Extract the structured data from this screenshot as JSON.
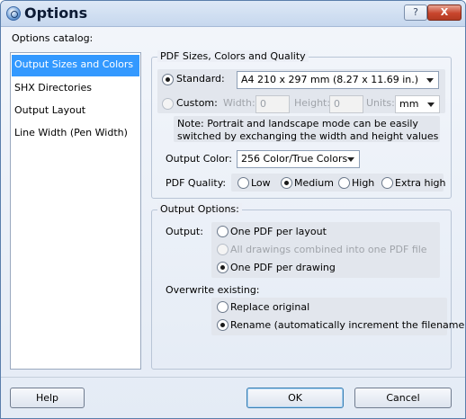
{
  "window": {
    "title": "Options",
    "help_btn": "?",
    "close_btn": "X"
  },
  "catalog": {
    "label": "Options catalog:",
    "items": [
      "Output Sizes and Colors",
      "SHX Directories",
      "Output Layout",
      "Line Width (Pen Width)"
    ]
  },
  "pdf": {
    "group_title": "PDF Sizes, Colors and Quality",
    "standard_label": "Standard:",
    "standard_value": "A4 210 x 297 mm (8.27 x 11.69 in.)",
    "custom_label": "Custom:",
    "width_label": "Width:",
    "width_value": "0",
    "height_label": "Height:",
    "height_value": "0",
    "units_label": "Units:",
    "units_value": "mm",
    "note": "Note: Portrait and landscape mode can be easily switched by exchanging the width and height values",
    "color_label": "Output Color:",
    "color_value": "256 Color/True Colors",
    "quality_label": "PDF Quality:",
    "quality_options": [
      "Low",
      "Medium",
      "High",
      "Extra high"
    ],
    "quality_selected": "Medium"
  },
  "output": {
    "group_title": "Output Options:",
    "output_label": "Output:",
    "options": [
      "One PDF per layout",
      "All drawings combined into one PDF file",
      "One PDF per drawing"
    ],
    "selected": "One PDF per drawing",
    "overwrite_label": "Overwrite existing:",
    "overwrite_options": [
      "Replace original",
      "Rename (automatically increment the filename)"
    ],
    "overwrite_selected": "Rename (automatically increment the filename)"
  },
  "buttons": {
    "help": "Help",
    "ok": "OK",
    "cancel": "Cancel"
  }
}
